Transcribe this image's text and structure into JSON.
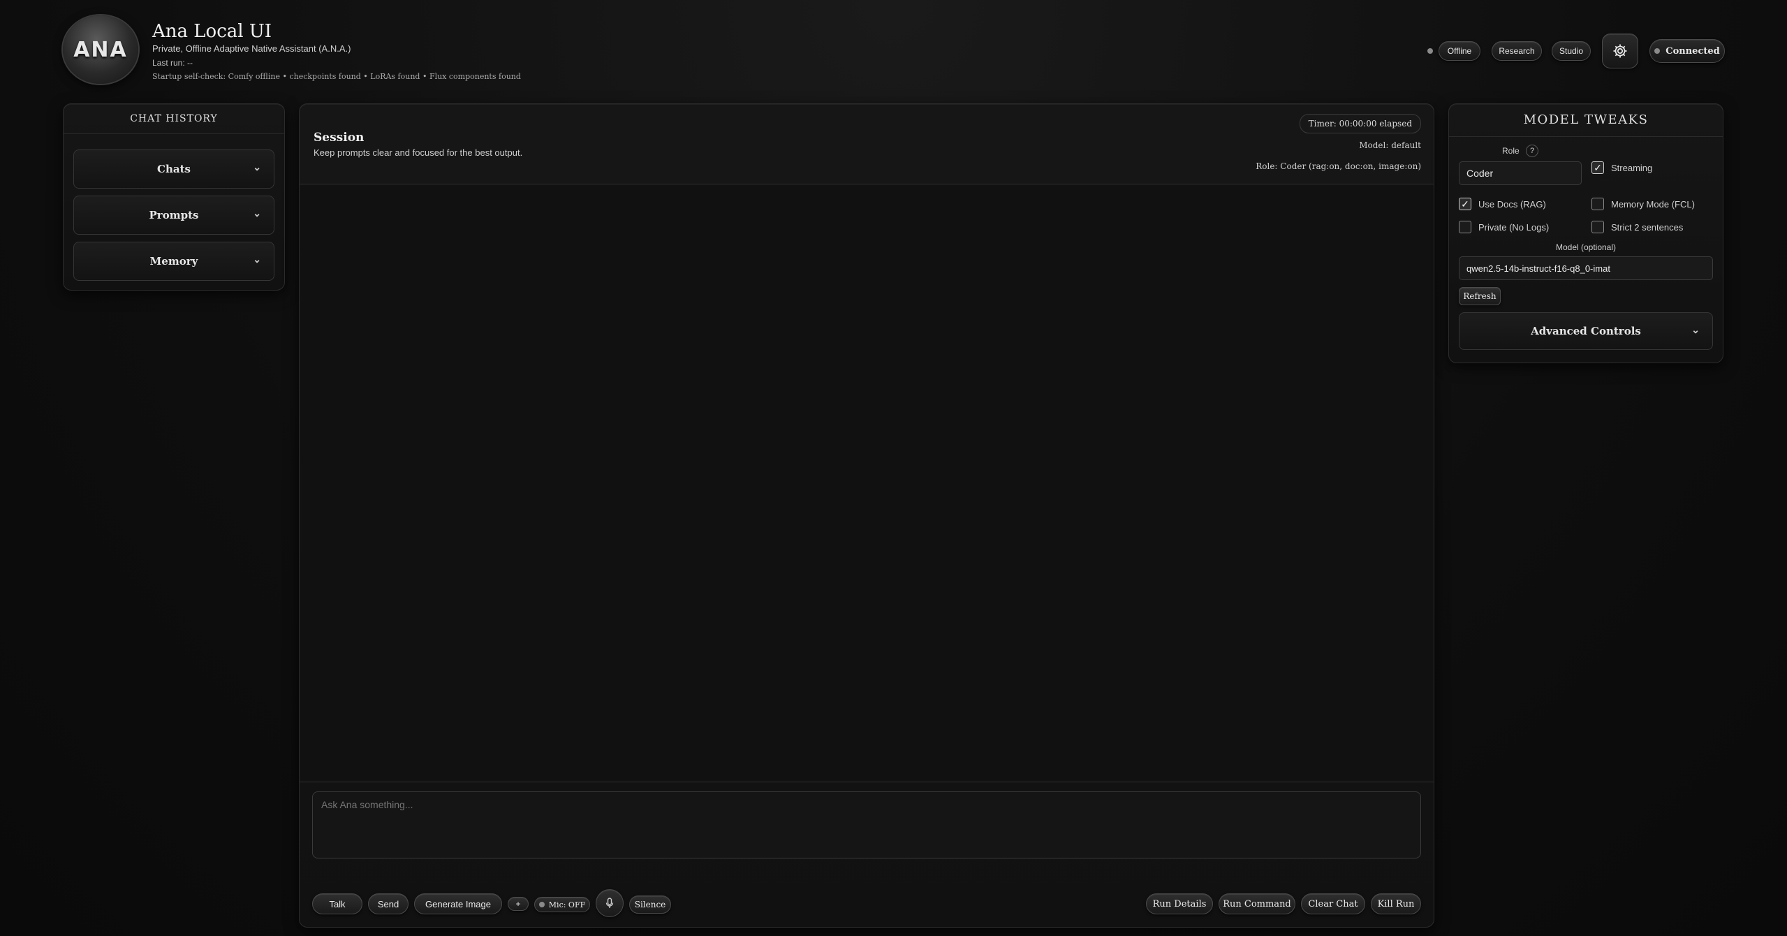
{
  "header": {
    "logo_text": "ANA",
    "title": "Ana Local UI",
    "subtitle": "Private, Offline Adaptive Native Assistant (A.N.A.)",
    "last_run": "Last run: --",
    "self_check": "Startup self-check: Comfy offline • checkpoints found • LoRAs found • Flux components found",
    "modes": [
      "Offline",
      "Research",
      "Studio"
    ],
    "connection": "Connected"
  },
  "sidebar": {
    "title": "CHAT HISTORY",
    "sections": [
      "Chats",
      "Prompts",
      "Memory"
    ]
  },
  "session": {
    "title": "Session",
    "hint": "Keep prompts clear and focused for the best output.",
    "timer": "Timer: 00:00:00 elapsed",
    "model": "Model: default",
    "role": "Role: Coder (rag:on, doc:on, image:on)"
  },
  "composer": {
    "placeholder": "Ask Ana something...",
    "left_buttons": [
      "Talk",
      "Send",
      "Generate Image",
      "+"
    ],
    "mic_status": "Mic: OFF",
    "silence": "Silence",
    "right_buttons": [
      "Run Details",
      "Run Command",
      "Clear Chat",
      "Kill Run"
    ]
  },
  "tweaks": {
    "title": "MODEL TWEAKS",
    "role_label": "Role",
    "role_help": "?",
    "role_value": "Coder",
    "streaming_label": "Streaming",
    "streaming": true,
    "use_docs_label": "Use Docs (RAG)",
    "use_docs": true,
    "memory_mode_label": "Memory Mode (FCL)",
    "memory_mode": false,
    "private_label": "Private (No Logs)",
    "private": false,
    "strict_label": "Strict 2 sentences",
    "strict": false,
    "model_label": "Model (optional)",
    "model_value": "qwen2.5-14b-instruct-f16-q8_0-imat",
    "refresh_label": "Refresh",
    "advanced_label": "Advanced Controls"
  },
  "colors": {
    "background": "#0e0e0e",
    "panel": "#141414",
    "border": "#2c2c2c",
    "text": "#d8d8d8"
  }
}
